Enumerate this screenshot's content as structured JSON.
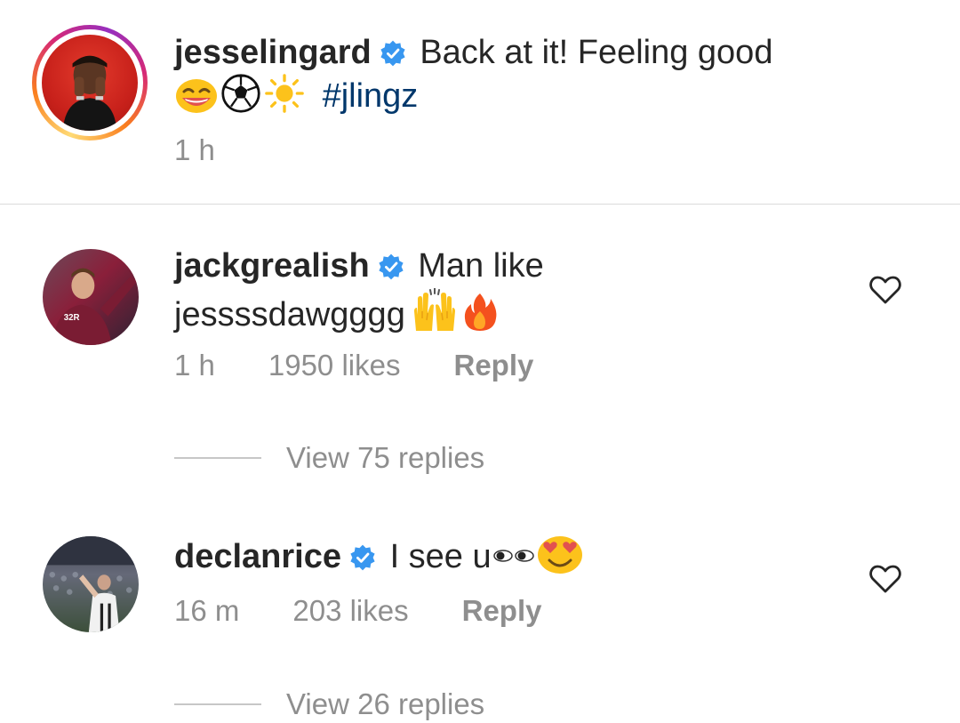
{
  "caption": {
    "username": "jesselingard",
    "text_line1": "Back at it! Feeling good",
    "emoji_names": [
      "smiling-face-icon",
      "soccer-ball-icon",
      "sun-icon"
    ],
    "hashtag": "#jlingz",
    "time": "1 h"
  },
  "comments": [
    {
      "username": "jackgrealish",
      "text_line1": "Man like",
      "text_line2": "jessssdawgggg",
      "emoji_names": [
        "raising-hands-icon",
        "fire-icon"
      ],
      "time": "1 h",
      "likes": "1950 likes",
      "reply_label": "Reply",
      "view_replies": "View 75 replies"
    },
    {
      "username": "declanrice",
      "text": "I see u",
      "emoji_names": [
        "eyes-icon",
        "heart-eyes-icon"
      ],
      "time": "16 m",
      "likes": "203 likes",
      "reply_label": "Reply",
      "view_replies": "View 26 replies"
    }
  ],
  "colors": {
    "verified": "#3897f0",
    "hashtag": "#00376b",
    "secondary_text": "#8e8e8e",
    "divider": "#dbdbdb"
  }
}
